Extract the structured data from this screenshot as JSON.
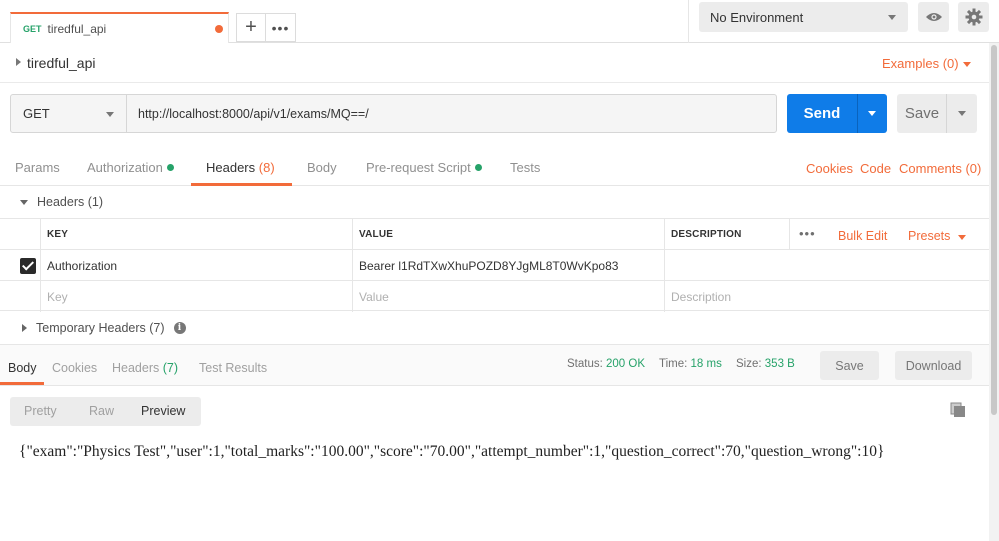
{
  "top_tab": {
    "method": "GET",
    "name": "tiredful_api"
  },
  "environment": {
    "selected": "No Environment"
  },
  "collection": {
    "title": "tiredful_api",
    "examples_label": "Examples (0)"
  },
  "request": {
    "method": "GET",
    "url": "http://localhost:8000/api/v1/exams/MQ==/",
    "send_label": "Send",
    "save_label": "Save"
  },
  "request_tabs": [
    {
      "label": "Params"
    },
    {
      "label": "Authorization"
    },
    {
      "label": "Headers",
      "count": "(8)"
    },
    {
      "label": "Body"
    },
    {
      "label": "Pre-request Script"
    },
    {
      "label": "Tests"
    }
  ],
  "request_links": {
    "cookies": "Cookies",
    "code": "Code",
    "comments": "Comments (0)"
  },
  "headers_section": {
    "title": "Headers (1)",
    "columns": {
      "key": "KEY",
      "value": "VALUE",
      "description": "DESCRIPTION"
    },
    "bulk_edit": "Bulk Edit",
    "presets": "Presets",
    "rows": [
      {
        "key": "Authorization",
        "value": "Bearer l1RdTXwXhuPOZD8YJgML8T0WvKpo83",
        "description": ""
      }
    ],
    "placeholder": {
      "key": "Key",
      "value": "Value",
      "description": "Description"
    },
    "temporary_label": "Temporary Headers (7)"
  },
  "response": {
    "tabs": [
      {
        "label": "Body"
      },
      {
        "label": "Cookies"
      },
      {
        "label": "Headers",
        "count": "(7)"
      },
      {
        "label": "Test Results"
      }
    ],
    "status_label": "Status:",
    "status_value": "200 OK",
    "time_label": "Time:",
    "time_value": "18 ms",
    "size_label": "Size:",
    "size_value": "353 B",
    "save_label": "Save",
    "download_label": "Download",
    "view_modes": [
      "Pretty",
      "Raw",
      "Preview"
    ],
    "body": "{\"exam\":\"Physics Test\",\"user\":1,\"total_marks\":\"100.00\",\"score\":\"70.00\",\"attempt_number\":1,\"question_correct\":70,\"question_wrong\":10}"
  },
  "colors": {
    "accent": "#f26b3a",
    "primary": "#0f7ce8",
    "success": "#26a269"
  }
}
